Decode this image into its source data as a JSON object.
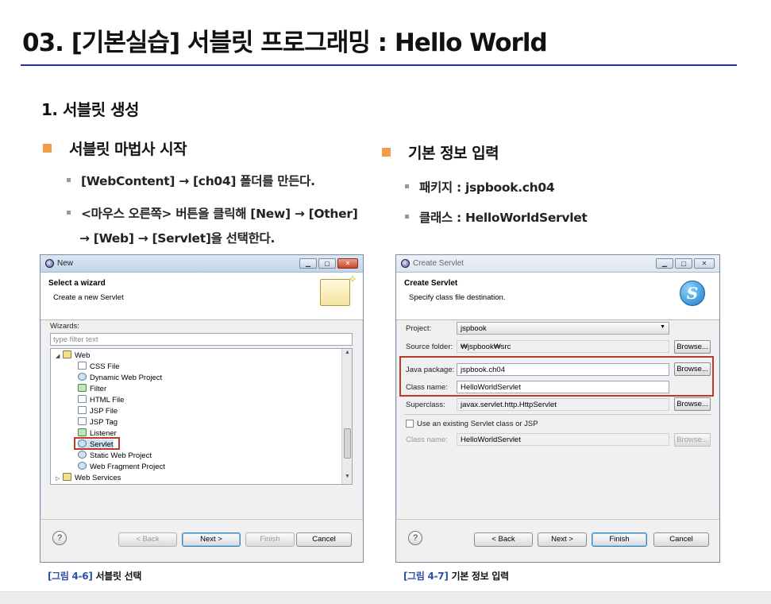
{
  "page": {
    "title": "03. [기본실습] 서블릿 프로그래밍 : Hello World",
    "section": "1. 서블릿 생성",
    "left_heading": "서블릿 마법사 시작",
    "left_bullets": [
      "[WebContent] → [ch04] 폴더를 만든다.",
      "<마우스 오른쪽> 버튼을 클릭해 [New] → [Other]",
      "→ [Web] → [Servlet]을 선택한다."
    ],
    "right_heading": "기본 정보 입력",
    "right_bullets": [
      "패키지 : jspbook.ch04",
      "클래스 : HelloWorldServlet"
    ],
    "accent_color": "#f29b4b",
    "rule_color": "#2b2bb0"
  },
  "new_wizard": {
    "window_title": "New",
    "header_title": "Select a wizard",
    "header_subtitle": "Create a new Servlet",
    "wizards_label": "Wizards:",
    "filter_placeholder": "type filter text",
    "tree": {
      "web_folder": "Web",
      "items": [
        "CSS File",
        "Dynamic Web Project",
        "Filter",
        "HTML File",
        "JSP File",
        "JSP Tag",
        "Listener",
        "Servlet",
        "Static Web Project",
        "Web Fragment Project"
      ],
      "next_folder": "Web Services",
      "selected": "Servlet"
    },
    "buttons": {
      "back": "< Back",
      "next": "Next >",
      "finish": "Finish",
      "cancel": "Cancel"
    },
    "help": "?"
  },
  "create_servlet": {
    "window_title": "Create Servlet",
    "header_title": "Create Servlet",
    "header_subtitle": "Specify class file destination.",
    "logo_letter": "S",
    "project_label": "Project:",
    "project_value": "jspbook",
    "source_folder_label": "Source folder:",
    "source_folder_value": "₩jspbook₩src",
    "java_package_label": "Java package:",
    "java_package_value": "jspbook.ch04",
    "class_name_label": "Class name:",
    "class_name_value": "HelloWorldServlet",
    "superclass_label": "Superclass:",
    "superclass_value": "javax.servlet.http.HttpServlet",
    "use_existing_label": "Use an existing Servlet class or JSP",
    "class_name2_label": "Class name:",
    "class_name2_value": "HelloWorldServlet",
    "browse": "Browse...",
    "buttons": {
      "back": "< Back",
      "next": "Next >",
      "finish": "Finish",
      "cancel": "Cancel"
    },
    "help": "?"
  },
  "captions": {
    "fig1_num": "[그림 4-6]",
    "fig1_text": "서블릿 선택",
    "fig2_num": "[그림 4-7]",
    "fig2_text": "기본 정보 입력"
  }
}
